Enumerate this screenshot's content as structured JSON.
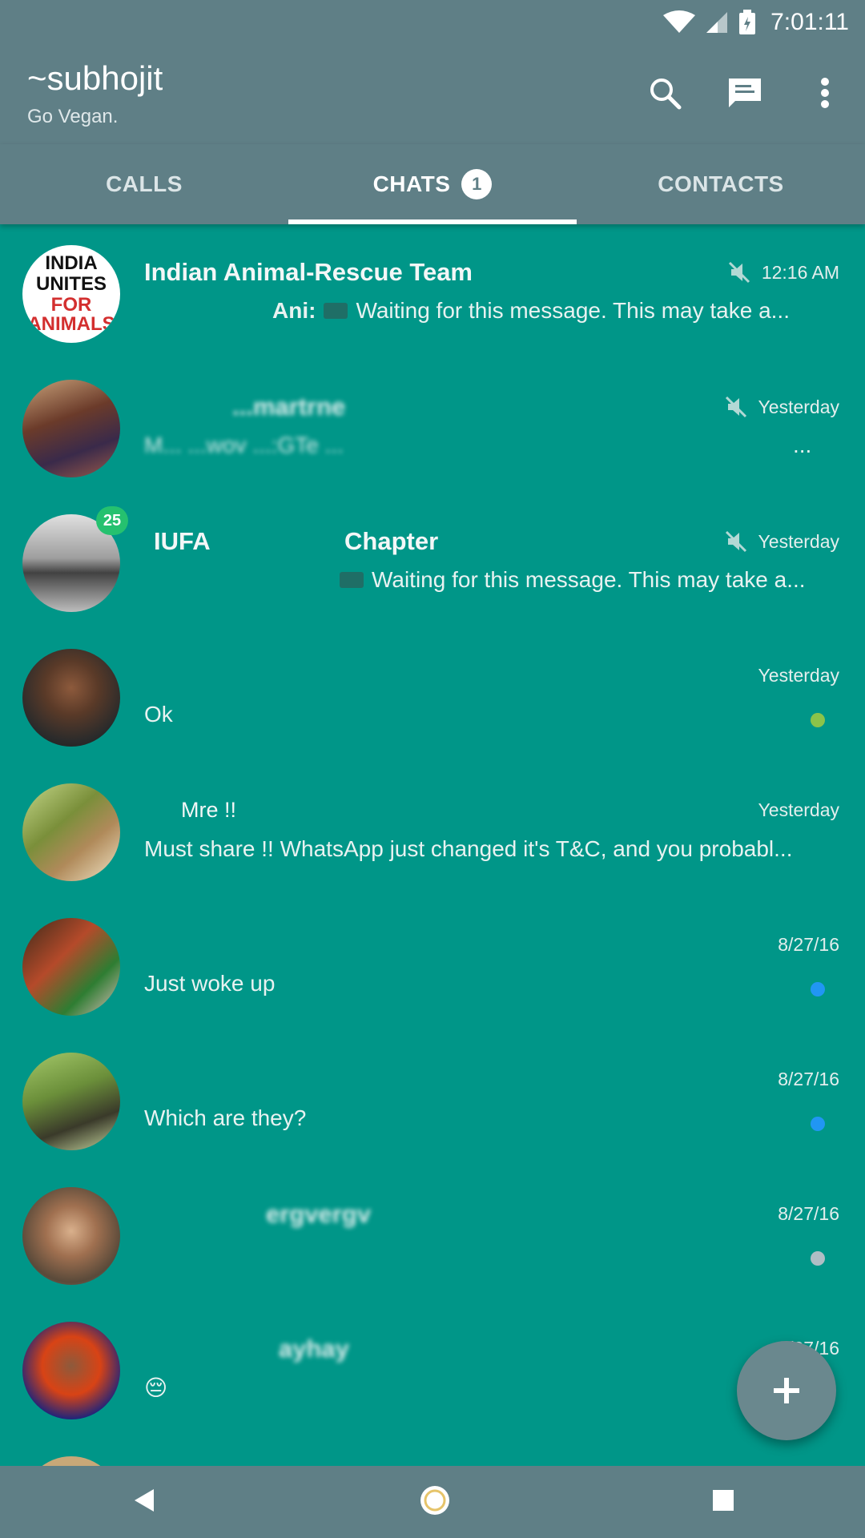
{
  "status_bar": {
    "time": "7:01:11",
    "icons": [
      "wifi-icon",
      "signal-icon",
      "battery-icon"
    ]
  },
  "app_bar": {
    "title": "~subhojit",
    "subtitle": "Go Vegan.",
    "actions": [
      "search-icon",
      "new-message-icon",
      "more-vert-icon"
    ]
  },
  "tabs": [
    {
      "label": "CALLS",
      "active": false
    },
    {
      "label": "CHATS",
      "active": true,
      "badge": "1"
    },
    {
      "label": "CONTACTS",
      "active": false
    }
  ],
  "chats": [
    {
      "name": "Indian Animal-Rescue Team",
      "time": "12:16 AM",
      "muted": true,
      "sender": "Ani:",
      "preview": "Waiting for this message. This may take a...",
      "avatar_text_1": "INDIA",
      "avatar_text_2": "UNITES",
      "avatar_text_3": "FOR",
      "avatar_text_4": "ANIMALS"
    },
    {
      "name": "...martrne",
      "time": "Yesterday",
      "muted": true,
      "preview": "M... ...wov ...:GTe ...",
      "preview_end": "..."
    },
    {
      "name_prefix": "IUFA",
      "name_suffix": "Chapter",
      "time": "Yesterday",
      "muted": true,
      "unread": "25",
      "preview": "Waiting for this message. This may take a..."
    },
    {
      "name": "",
      "time": "Yesterday",
      "preview": "Ok",
      "dot_color": "#8bc34a"
    },
    {
      "name": "Mre !!",
      "time": "Yesterday",
      "preview": "Must share !!   WhatsApp just changed it's T&C, and you probabl..."
    },
    {
      "name": "",
      "time": "8/27/16",
      "preview": "Just woke up",
      "dot_color": "#2196f3"
    },
    {
      "name": "",
      "time": "8/27/16",
      "preview": "Which are they?",
      "dot_color": "#2196f3"
    },
    {
      "name": "ergvergv",
      "time": "8/27/16",
      "preview": "",
      "dot_color": "#b0bec5"
    },
    {
      "name": "ayhay",
      "time": "8/27/16",
      "preview": "😔"
    }
  ],
  "fab": {
    "icon": "plus-icon"
  },
  "nav_bar": {
    "icons": [
      "back-icon",
      "home-icon",
      "recents-icon"
    ]
  },
  "colors": {
    "primary": "#5f7f86",
    "background": "#009688",
    "unread_badge": "#25c16f"
  }
}
